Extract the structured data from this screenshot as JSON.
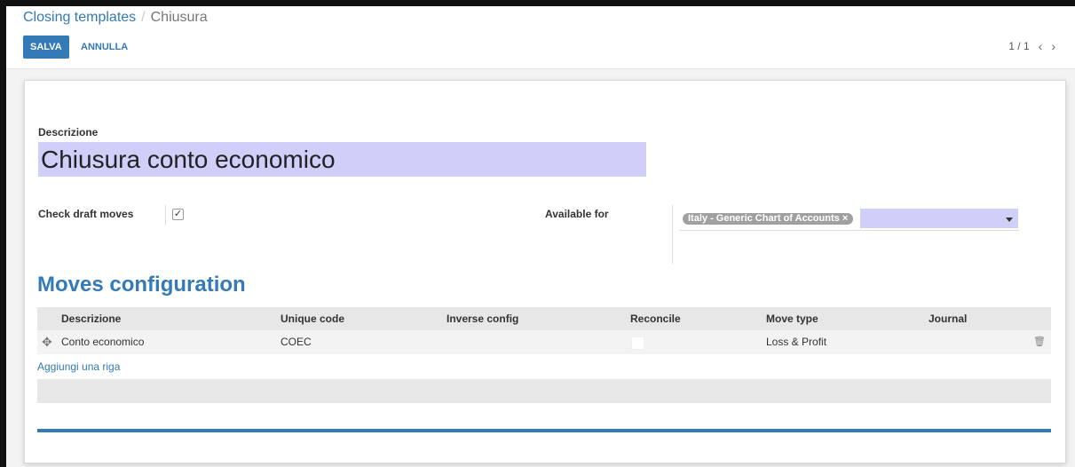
{
  "breadcrumb": {
    "parent": "Closing templates",
    "separator": "/",
    "current": "Chiusura"
  },
  "toolbar": {
    "save_label": "SALVA",
    "discard_label": "ANNULLA"
  },
  "pager": {
    "value": "1 / 1",
    "prev_icon": "chevron-left-icon",
    "next_icon": "chevron-right-icon"
  },
  "form": {
    "description_label": "Descrizione",
    "description_value": "Chiusura conto economico",
    "check_draft_label": "Check draft moves",
    "check_draft_checked": true,
    "available_for_label": "Available for",
    "available_for_tag": "Italy - Generic Chart of Accounts",
    "tag_remove": "×"
  },
  "moves": {
    "section_title": "Moves configuration",
    "columns": [
      "Descrizione",
      "Unique code",
      "Inverse config",
      "Reconcile",
      "Move type",
      "Journal"
    ],
    "rows": [
      {
        "descrizione": "Conto economico",
        "unique_code": "COEC",
        "inverse_config": "",
        "reconcile": false,
        "move_type": "Loss & Profit",
        "journal": ""
      }
    ],
    "add_line_label": "Aggiungi una riga"
  },
  "colors": {
    "accent": "#337ab7",
    "input_highlight": "#cfcffa",
    "tag_bg": "#a0a0a0"
  }
}
